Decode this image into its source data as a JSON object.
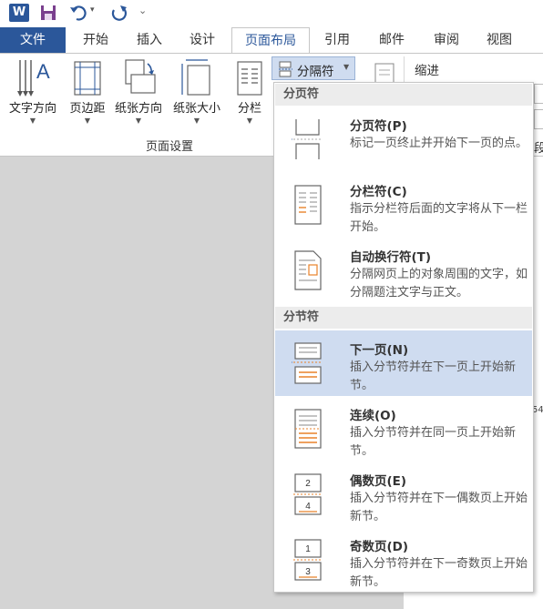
{
  "qat": {
    "more": "⌄"
  },
  "tabs": [
    {
      "label": "文件"
    },
    {
      "label": "开始"
    },
    {
      "label": "插入"
    },
    {
      "label": "设计"
    },
    {
      "label": "页面布局"
    },
    {
      "label": "引用"
    },
    {
      "label": "邮件"
    },
    {
      "label": "审阅"
    },
    {
      "label": "视图"
    }
  ],
  "ribbon": {
    "text_direction": "文字方向",
    "margins": "页边距",
    "orientation": "纸张方向",
    "size": "纸张大小",
    "columns": "分栏",
    "breaks": "分隔符",
    "indent": "缩进",
    "group_label": "页面设置",
    "side_fragment_1": "段",
    "side_fragment_2": "54"
  },
  "menu": {
    "section1": "分页符",
    "section2": "分节符",
    "items": [
      {
        "title": "分页符(P)",
        "desc": "标记一页终止并开始下一页的点。"
      },
      {
        "title": "分栏符(C)",
        "desc": "指示分栏符后面的文字将从下一栏开始。"
      },
      {
        "title": "自动换行符(T)",
        "desc": "分隔网页上的对象周围的文字，如分隔题注文字与正文。"
      },
      {
        "title": "下一页(N)",
        "desc": "插入分节符并在下一页上开始新节。"
      },
      {
        "title": "连续(O)",
        "desc": "插入分节符并在同一页上开始新节。"
      },
      {
        "title": "偶数页(E)",
        "desc": "插入分节符并在下一偶数页上开始新节。"
      },
      {
        "title": "奇数页(D)",
        "desc": "插入分节符并在下一奇数页上开始新节。"
      }
    ]
  },
  "colors": {
    "accent": "#2b579a",
    "highlight": "#cfdcf0",
    "orange": "#e8822a"
  }
}
